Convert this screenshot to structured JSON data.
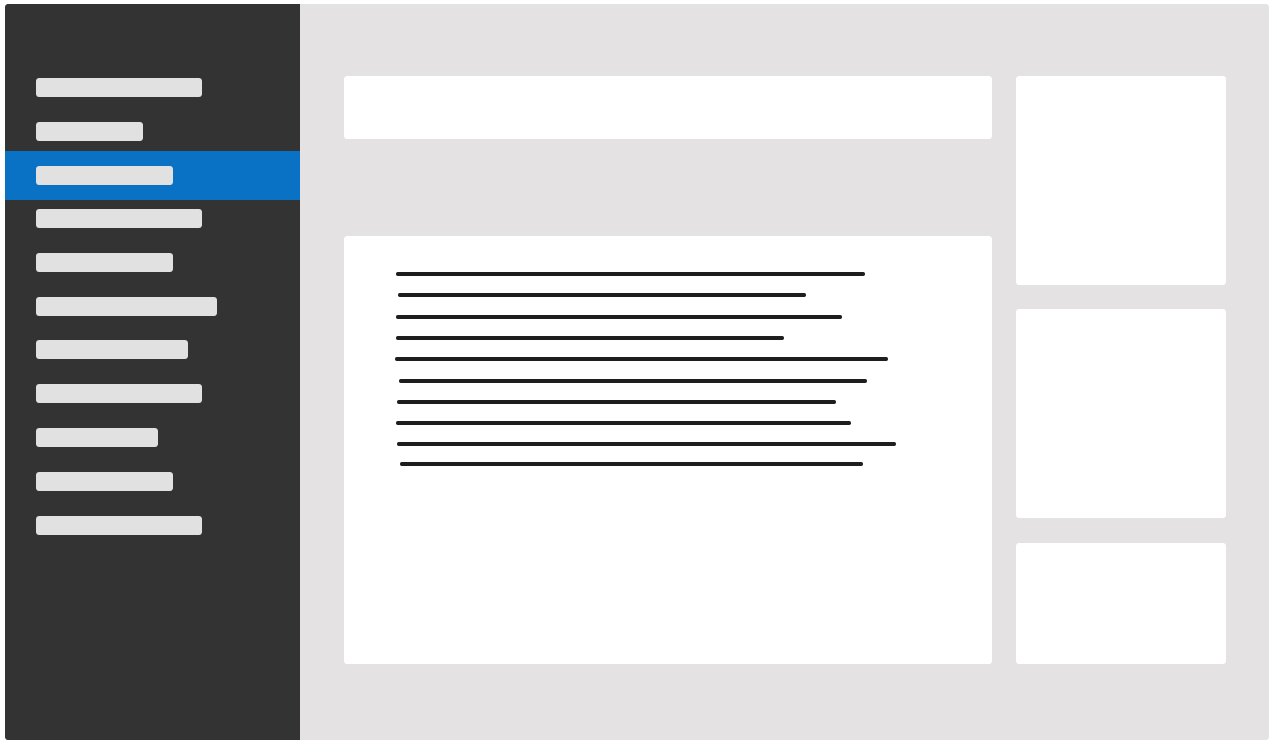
{
  "colors": {
    "sidebar_background": "#333333",
    "sidebar_active": "#0a72c4",
    "placeholder_bar": "#e2e1e2",
    "workspace_background": "#e4e2e3",
    "panel_background": "#ffffff",
    "text_line": "#1e1e1e"
  },
  "sidebar": {
    "active_index": 2,
    "item_count": 11
  },
  "content": {
    "text_line_count": 10
  },
  "widgets": {
    "count": 3
  }
}
